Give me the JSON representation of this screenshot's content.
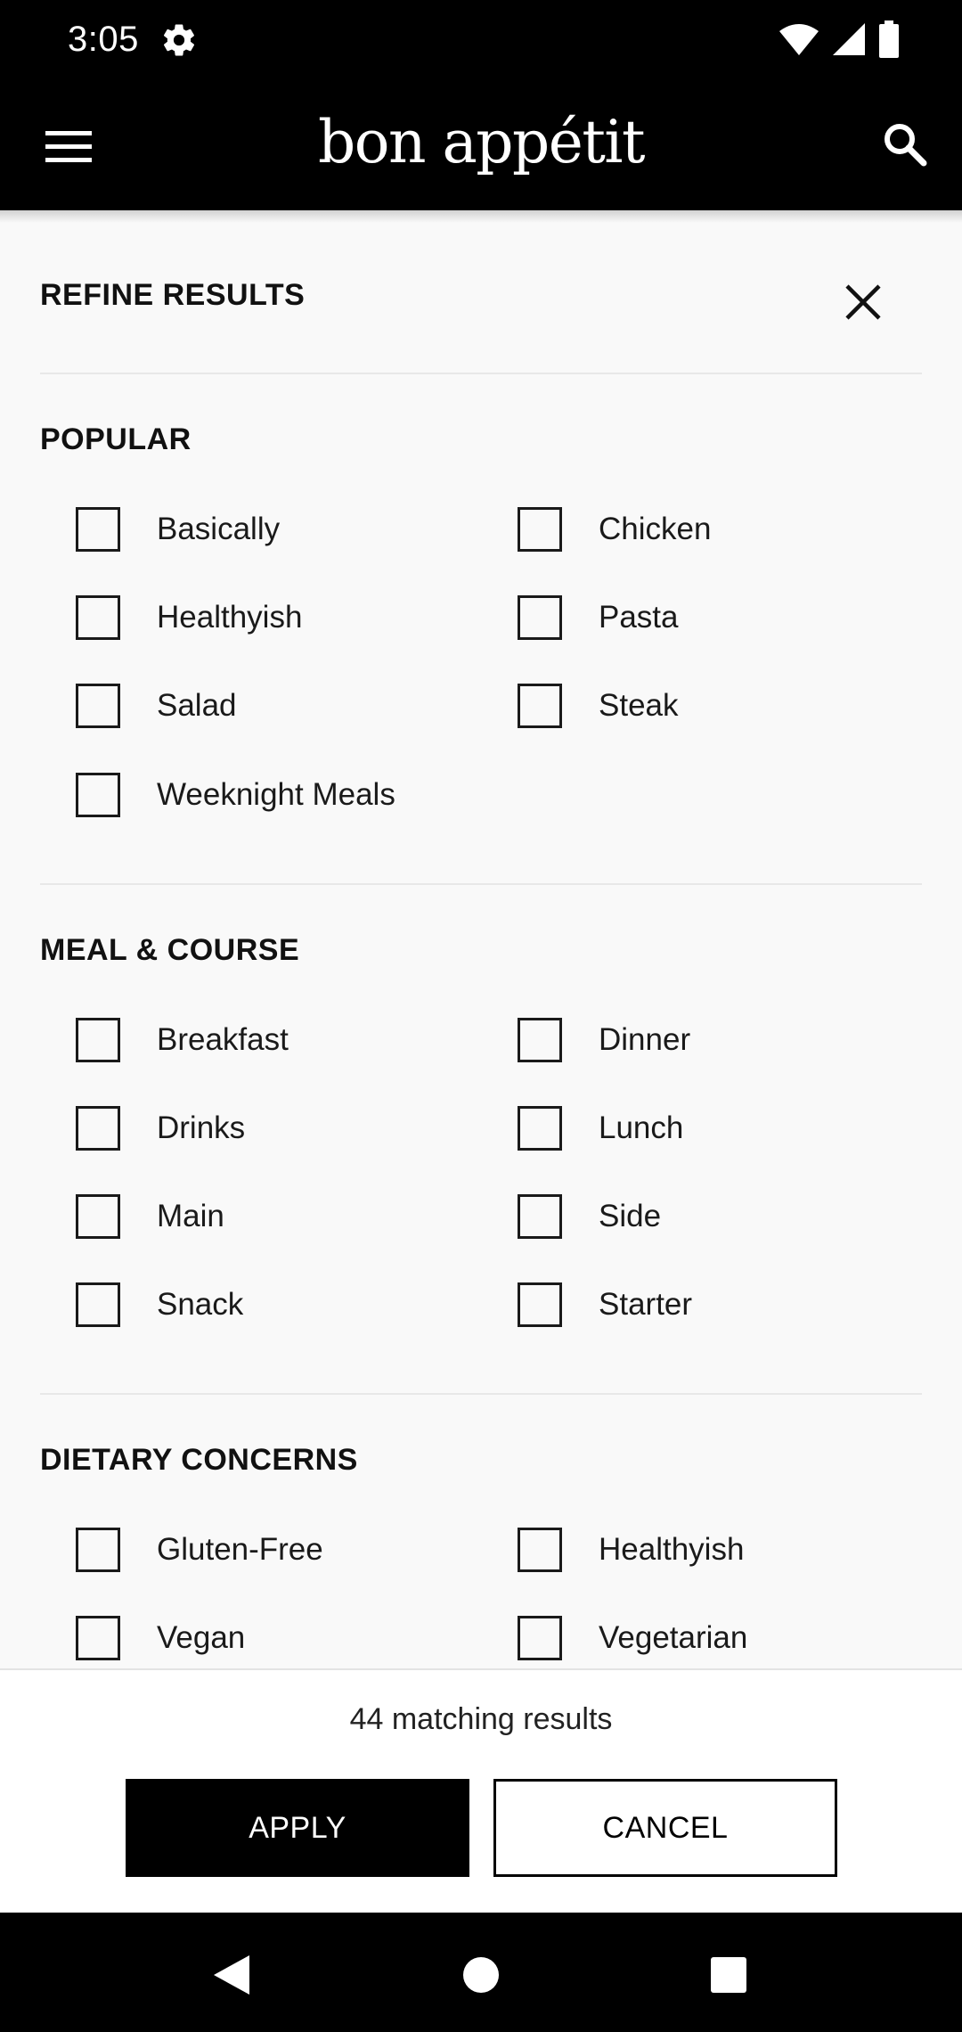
{
  "status_bar": {
    "time": "3:05"
  },
  "app_bar": {
    "brand": "bon appétit"
  },
  "panel": {
    "title": "REFINE RESULTS",
    "sections": [
      {
        "title": "POPULAR",
        "options": [
          "Basically",
          "Chicken",
          "Healthyish",
          "Pasta",
          "Salad",
          "Steak",
          "Weeknight Meals"
        ]
      },
      {
        "title": "MEAL & COURSE",
        "options": [
          "Breakfast",
          "Dinner",
          "Drinks",
          "Lunch",
          "Main",
          "Side",
          "Snack",
          "Starter"
        ]
      },
      {
        "title": "DIETARY CONCERNS",
        "options": [
          "Gluten-Free",
          "Healthyish",
          "Vegan",
          "Vegetarian"
        ]
      }
    ]
  },
  "footer": {
    "results": "44 matching results",
    "apply_label": "APPLY",
    "cancel_label": "CANCEL"
  },
  "icons": {
    "status": [
      "gear-icon",
      "wifi-icon",
      "signal-icon",
      "battery-icon"
    ],
    "app_bar": [
      "menu-icon",
      "search-icon"
    ],
    "panel": [
      "close-icon"
    ],
    "nav": [
      "back-icon",
      "home-icon",
      "recents-icon"
    ]
  },
  "colors": {
    "bar_background": "#000000",
    "panel_background": "#f9f9f9",
    "primary_button": "#000000",
    "text": "#1a1a1a"
  }
}
